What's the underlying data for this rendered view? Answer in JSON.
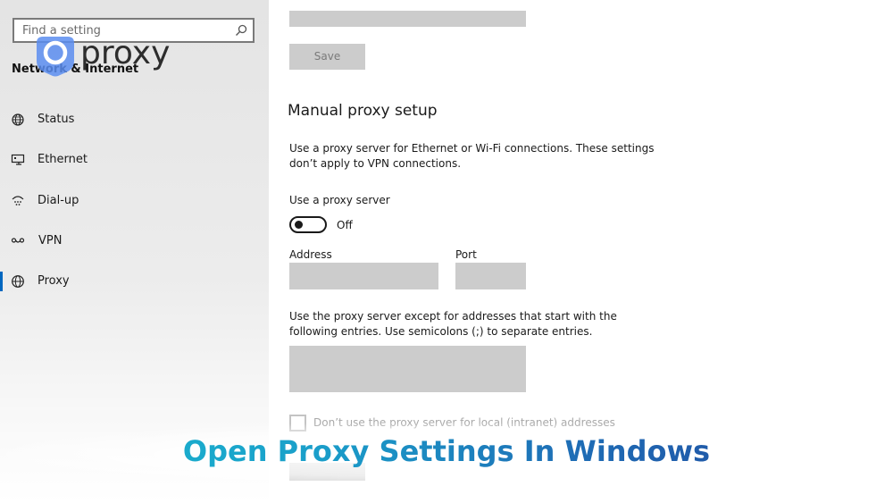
{
  "search": {
    "placeholder": "Find a setting",
    "icon": "search-icon"
  },
  "sidebar": {
    "section_title": "Network & Internet",
    "items": [
      {
        "label": "Status",
        "icon": "globe-status-icon",
        "active": false
      },
      {
        "label": "Ethernet",
        "icon": "ethernet-icon",
        "active": false
      },
      {
        "label": "Dial-up",
        "icon": "dial-up-icon",
        "active": false
      },
      {
        "label": "VPN",
        "icon": "vpn-icon",
        "active": false
      },
      {
        "label": "Proxy",
        "icon": "globe-icon",
        "active": true
      }
    ]
  },
  "logo": {
    "text": "proxy",
    "icon": "location-pin-icon"
  },
  "top": {
    "save_label": "Save"
  },
  "manual": {
    "heading": "Manual proxy setup",
    "description": "Use a proxy server for Ethernet or Wi-Fi connections. These settings don’t apply to VPN connections.",
    "use_proxy_label": "Use a proxy server",
    "toggle_state": "Off",
    "address_label": "Address",
    "port_label": "Port",
    "exceptions_description": "Use the proxy server except for addresses that start with the following entries. Use semicolons (;) to separate entries.",
    "local_checkbox_label": "Don’t use the proxy server for local (intranet) addresses"
  },
  "caption": {
    "text": "Open Proxy Settings In Windows"
  },
  "colors": {
    "sidebar_bg": "#e6e6e6",
    "field_bg": "#cccccc",
    "accent": "#0067c0",
    "caption_start": "#1bbbcf",
    "caption_end": "#24449a"
  }
}
